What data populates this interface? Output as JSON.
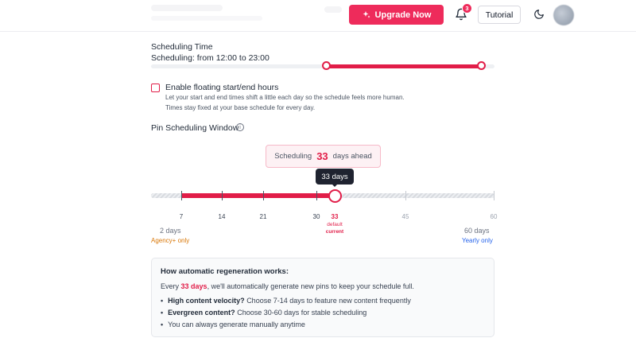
{
  "header": {
    "upgrade_label": "Upgrade Now",
    "notification_count": "3",
    "tutorial_label": "Tutorial"
  },
  "scheduling_time": {
    "title": "Scheduling Time",
    "summary": "Scheduling: from 12:00 to 23:00",
    "range_start_fraction": 0.51,
    "range_end_fraction": 0.96
  },
  "floating": {
    "label": "Enable floating start/end hours",
    "description_1": "Let your start and end times shift a little each day so the schedule feels more human.",
    "description_2": "Times stay fixed at your base schedule for every day.",
    "checked": false
  },
  "pin_window": {
    "title": "Pin Scheduling Window",
    "info_icon": "info-icon",
    "summary_prefix": "Scheduling",
    "summary_value": "33",
    "summary_suffix": "days ahead",
    "tooltip": "33 days",
    "value": 33,
    "min": 2,
    "max": 60,
    "ticks": [
      "7",
      "14",
      "21",
      "30",
      "33",
      "45",
      "60"
    ],
    "default_label": "default",
    "current_label": "current",
    "min_label": "2 days",
    "min_note": "Agency+ only",
    "max_label": "60 days",
    "max_note": "Yearly only"
  },
  "regeneration": {
    "heading": "How automatic regeneration works:",
    "para_prefix": "Every",
    "para_highlight": "33 days",
    "para_suffix": ", we'll automatically generate new pins to keep your schedule full.",
    "bullet_1_bold": "High content velocity?",
    "bullet_1_text": "Choose 7-14 days to feature new content frequently",
    "bullet_2_bold": "Evergreen content?",
    "bullet_2_text": "Choose 30-60 days for stable scheduling",
    "bullet_3_text": "You can always generate manually anytime"
  },
  "colors": {
    "accent": "#e11d48",
    "upgrade": "#ee2b5b",
    "agency": "#d97706",
    "yearly": "#2563eb"
  }
}
